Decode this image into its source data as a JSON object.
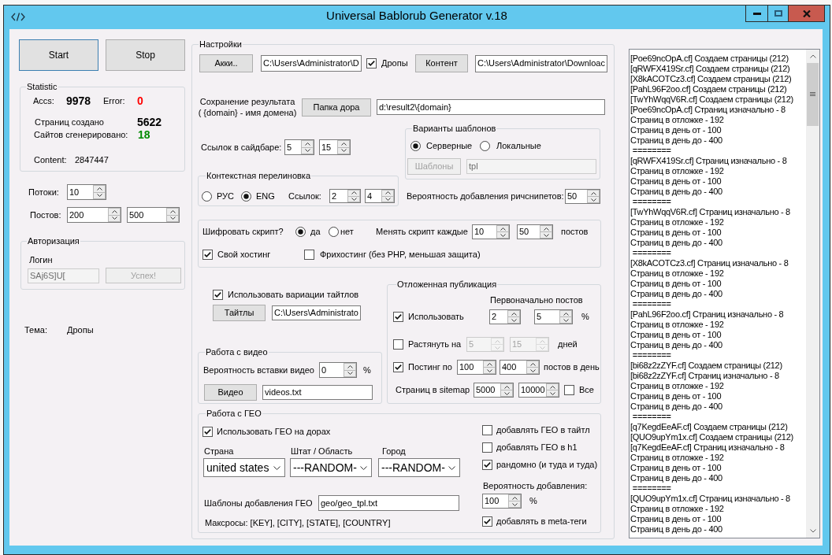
{
  "window": {
    "title": "Universal Bablorub Generator v.18"
  },
  "run_buttons": [
    {
      "label": "Start",
      "focused": true
    },
    {
      "label": "Stop",
      "focused": false
    }
  ],
  "statistic": {
    "title": "Statistic",
    "accs_label": "Accs:",
    "accs": "9978",
    "error_label": "Error:",
    "error": "0",
    "pages_label": "Страниц создано",
    "pages": "5622",
    "sites_label": "Сайтов сгенерировано:",
    "sites": "18",
    "content_label": "Content:",
    "content": "2847447"
  },
  "threads": {
    "label": "Потоки:",
    "value": "10"
  },
  "posts": {
    "label": "Постов:",
    "values": [
      "200",
      "500"
    ]
  },
  "authorization": {
    "title": "Авторизация",
    "login_label": "Логин",
    "login": {
      "value": "SAj6S]U[",
      "disabled": true
    },
    "button": {
      "label": "Успех!",
      "disabled": true
    }
  },
  "theme": {
    "label": "Тема:",
    "value": "Дропы"
  },
  "settings": {
    "title": "Настройки",
    "accounts": {
      "button": "Акки..",
      "path": "C:\\Users\\Administrator\\D"
    },
    "drops": {
      "label": "Дропы",
      "checked": true
    },
    "content": {
      "button": "Контент",
      "path": "C:\\Users\\Administrator\\Downloac"
    },
    "result": {
      "label_lines": [
        "Сохранение результата",
        "( {domain} - имя домена)"
      ],
      "button": "Папка дора",
      "path": "d:\\result2\\{domain}"
    },
    "sidebar_links": {
      "label": "Ссылок в сайдбаре:",
      "values": [
        "5",
        "15"
      ]
    },
    "templates": {
      "title": "Варианты шаблонов",
      "options": [
        {
          "label": "Серверные",
          "selected": true
        },
        {
          "label": "Локальные",
          "selected": false
        }
      ],
      "button": {
        "label": "Шаблоны",
        "disabled": true
      },
      "field": {
        "value": "tpl",
        "disabled": true
      }
    },
    "context_linking": {
      "title": "Контекстная перелиновка",
      "options": [
        {
          "label": "РУС",
          "selected": false
        },
        {
          "label": "ENG",
          "selected": true
        }
      ],
      "links_label": "Ссылок:",
      "values": [
        "2",
        "4"
      ]
    },
    "rich_snippets": {
      "label": "Вероятность добавления ричснипетов:",
      "value": "50"
    },
    "encryption": {
      "label": "Шифровать скрипт?",
      "options": [
        {
          "label": "да",
          "selected": true
        },
        {
          "label": "нет",
          "selected": false
        }
      ],
      "change_label": "Менять скрипт каждые",
      "values": [
        "10",
        "50"
      ],
      "unit": "постов",
      "hosting": [
        {
          "label": "Свой хостинг",
          "checked": true
        },
        {
          "label": "Фрихостинг (без PHP, меньшая защита)",
          "checked": false
        }
      ]
    },
    "title_variations": {
      "label": "Использовать вариации тайтлов",
      "checked": true,
      "button": "Тайтлы",
      "path": "C:\\Users\\Administrato"
    },
    "video": {
      "title": "Работа с видео",
      "label": "Вероятность вставки видео",
      "value": "0",
      "unit": "%",
      "button": "Видео",
      "path": "videos.txt"
    },
    "delayed": {
      "title": "Отложенная публикация",
      "initial_label": "Первоначально постов",
      "rows": [
        {
          "label": "Использовать",
          "checked": true,
          "disabled": false,
          "values": [
            "2",
            "5"
          ],
          "unit": "%"
        },
        {
          "label": "Растянуть на",
          "checked": false,
          "disabled": true,
          "values": [
            "5",
            "15"
          ],
          "unit": "дней"
        },
        {
          "label": "Постинг по",
          "checked": true,
          "disabled": false,
          "values": [
            "100",
            "400"
          ],
          "unit": "постов в день"
        }
      ],
      "sitemap": {
        "label": "Страниц в sitemap",
        "values": [
          "5000",
          "10000"
        ],
        "all": {
          "label": "Все",
          "checked": false
        }
      }
    },
    "geo": {
      "title": "Работа с ГЕО",
      "use": {
        "label": "Использовать ГЕО на дорах",
        "checked": true
      },
      "selects": [
        {
          "label": "Страна",
          "value": "united states"
        },
        {
          "label": "Штат / Область",
          "value": "---RANDOM-"
        },
        {
          "label": "Город",
          "value": "---RANDOM-"
        }
      ],
      "templates": {
        "label": "Шаблоны добавления ГЕО",
        "path": "geo/geo_tpl.txt"
      },
      "macros": "Максросы: [KEY], [CITY], [STATE], [COUNTRY]",
      "placement": [
        {
          "label": "добавлять ГЕО в тайтл",
          "checked": false
        },
        {
          "label": "добавлять ГЕО в h1",
          "checked": false
        },
        {
          "label": "рандомно (и туда и туда)",
          "checked": true
        }
      ],
      "probability": {
        "label": "Вероятность добавления:",
        "value": "100",
        "unit": "%"
      },
      "meta": {
        "label": "добавлять в meta-теги",
        "checked": true
      }
    }
  },
  "log": {
    "lines": [
      "[Poe69ncOpA.cf] Создаем страницы (212)",
      "[qRWFX419Sr.cf] Создаем страницы (212)",
      "[X8kACOTCz3.cf] Создаем страницы (212)",
      "[PahL96F2oo.cf] Создаем страницы (212)",
      "[TwYhWqqV6R.cf] Создаем страницы (212)",
      "[Poe69ncOpA.cf] Страниц изначально - 8",
      "Страниц в отложке - 192",
      "Страниц в день от - 100",
      "Страниц в день до - 400",
      " ========",
      "[qRWFX419Sr.cf] Страниц изначально - 8",
      "Страниц в отложке - 192",
      "Страниц в день от - 100",
      "Страниц в день до - 400",
      " ========",
      "[TwYhWqqV6R.cf] Страниц изначально - 8",
      "Страниц в отложке - 192",
      "Страниц в день от - 100",
      "Страниц в день до - 400",
      " ========",
      "[X8kACOTCz3.cf] Страниц изначально - 8",
      "Страниц в отложке - 192",
      "Страниц в день от - 100",
      "Страниц в день до - 400",
      " ========",
      "[PahL96F2oo.cf] Страниц изначально - 8",
      "Страниц в отложке - 192",
      "Страниц в день от - 100",
      "Страниц в день до - 400",
      " ========",
      "[bi68z2zZYF.cf] Создаем страницы (212)",
      "[bi68z2zZYF.cf] Страниц изначально - 8",
      "Страниц в отложке - 192",
      "Страниц в день от - 100",
      "Страниц в день до - 400",
      " ========",
      "[q7KegdEeAF.cf] Создаем страницы (212)",
      "[QUO9upYm1x.cf] Создаем страницы (212)",
      "[q7KegdEeAF.cf] Страниц изначально - 8",
      "Страниц в отложке - 192",
      "Страниц в день от - 100",
      "Страниц в день до - 400",
      " ========",
      "[QUO9upYm1x.cf] Страниц изначально - 8",
      "Страниц в отложке - 192",
      "Страниц в день от - 100",
      "Страниц в день до - 400"
    ]
  }
}
